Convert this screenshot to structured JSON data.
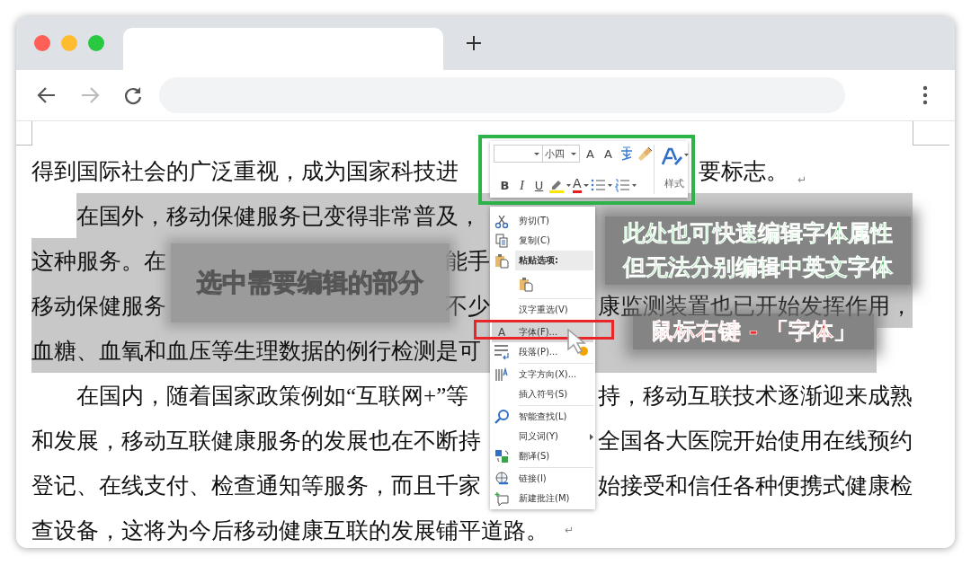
{
  "document": {
    "lines": [
      {
        "indent": false,
        "selected": false,
        "left": "得到国际社会的广泛重视，成为国家科技进",
        "right": "要标志。",
        "para_mark": "↵"
      },
      {
        "indent": true,
        "selected": true,
        "left": "在国外，移动保健服务已变得非常普及，"
      },
      {
        "indent": false,
        "selected": true,
        "left": "这种服务。在",
        "middle": "能手"
      },
      {
        "indent": false,
        "selected": true,
        "left": "移动保健服务",
        "middle": "不少",
        "right": "康监测装置也已开始发挥作用，"
      },
      {
        "indent": false,
        "selected": true,
        "left": "血糖、血氧和血压等生理数据的例行检测是可"
      },
      {
        "indent": true,
        "selected": false,
        "left": "在国内，随着国家政策例如“互联网+”等",
        "right": "持，移动互联技术逐渐迎来成熟"
      },
      {
        "indent": false,
        "selected": false,
        "left": "和发展，移动互联健康服务的发展也在不断持",
        "right": "全国各大医院开始使用在线预约"
      },
      {
        "indent": false,
        "selected": false,
        "left": "登记、在线支付、检查通知等服务，而且千家",
        "right": "始接受和信任各种便携式健康检"
      },
      {
        "indent": false,
        "selected": false,
        "left": "查设备，这将为今后移动健康互联的发展铺平道路。",
        "para_mark": "↵"
      }
    ]
  },
  "mini_toolbar": {
    "font_size": "小四",
    "grow_glyph": "A",
    "shrink_glyph": "A",
    "format_buttons": [
      {
        "kind": "bold",
        "glyph": "B"
      },
      {
        "kind": "italic",
        "glyph": "I"
      },
      {
        "kind": "underline",
        "glyph": "U"
      }
    ],
    "font_color_glyph": "A",
    "styles_label": "样式"
  },
  "context_menu": {
    "items": [
      {
        "kind": "command",
        "label": "剪切(T)",
        "selected": false
      },
      {
        "kind": "command",
        "label": "复制(C)",
        "selected": false
      },
      {
        "kind": "header",
        "label": "粘贴选项:",
        "selected": false
      },
      {
        "kind": "paste_option",
        "selected": false
      },
      {
        "kind": "command",
        "label": "汉字重选(V)",
        "separator_before": true,
        "selected": false
      },
      {
        "kind": "command",
        "icon_glyph": "A",
        "label": "字体(F)...",
        "separator_before": true,
        "selected": true
      },
      {
        "kind": "command",
        "label": "段落(P)...",
        "selected": false
      },
      {
        "kind": "command",
        "label": "文字方向(X)...",
        "separator_before": true,
        "selected": false
      },
      {
        "kind": "command",
        "label": "插入符号(S)",
        "selected": false
      },
      {
        "kind": "command",
        "label": "智能查找(L)",
        "separator_before": true,
        "selected": false
      },
      {
        "kind": "command",
        "label": "同义词(Y)",
        "submenu": true,
        "selected": false
      },
      {
        "kind": "command",
        "label": "翻译(S)",
        "selected": false
      },
      {
        "kind": "command",
        "label": "链接(I)",
        "separator_before": true,
        "selected": false
      },
      {
        "kind": "command",
        "label": "新建批注(M)",
        "selected": false
      }
    ]
  },
  "annotations": [
    {
      "kind": "white",
      "lines": [
        "选中需要编辑的部分"
      ]
    },
    {
      "kind": "green",
      "lines": [
        "此处也可快速编辑字体属性",
        "但无法分别编辑中英文字体"
      ]
    },
    {
      "kind": "red",
      "lines": [
        "鼠标右键 - 「字体」"
      ]
    }
  ]
}
